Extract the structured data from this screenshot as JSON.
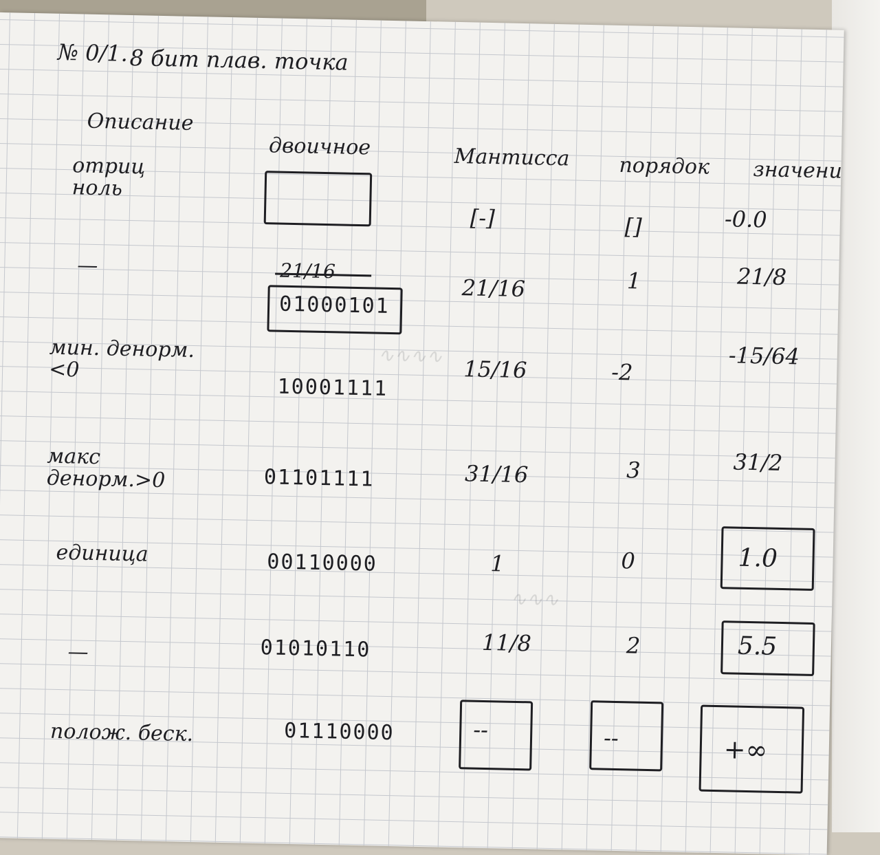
{
  "title": {
    "number": "№ 0/1.",
    "text": "8 бит плав. точка"
  },
  "headers": [
    "Описание",
    "двоичное",
    "Мантисса",
    "порядок",
    "значение"
  ],
  "rows": [
    {
      "desc": "отриц ноль",
      "binary": "",
      "mantissa": "[-]",
      "exponent": "[]",
      "value": "-0.0"
    },
    {
      "desc": "—",
      "binary_struck": "21/16",
      "binary": "01000101",
      "mantissa": "21/16",
      "exponent": "1",
      "value": "21/8"
    },
    {
      "desc": "мин. денорм.<0",
      "binary": "10001111",
      "mantissa": "15/16",
      "exponent": "-2",
      "value": "-15/64"
    },
    {
      "desc": "макс денорм.>0",
      "binary": "01101111",
      "mantissa": "31/16",
      "exponent": "3",
      "value": "31/2"
    },
    {
      "desc": "единица",
      "binary": "00110000",
      "mantissa": "1",
      "exponent": "0",
      "value": "1.0"
    },
    {
      "desc": "—",
      "binary": "01010110",
      "mantissa": "11/8",
      "exponent": "2",
      "value": "5.5"
    },
    {
      "desc": "полож. беск.",
      "binary": "01110000",
      "mantissa": "--",
      "exponent": "--",
      "value": "+∞"
    }
  ]
}
